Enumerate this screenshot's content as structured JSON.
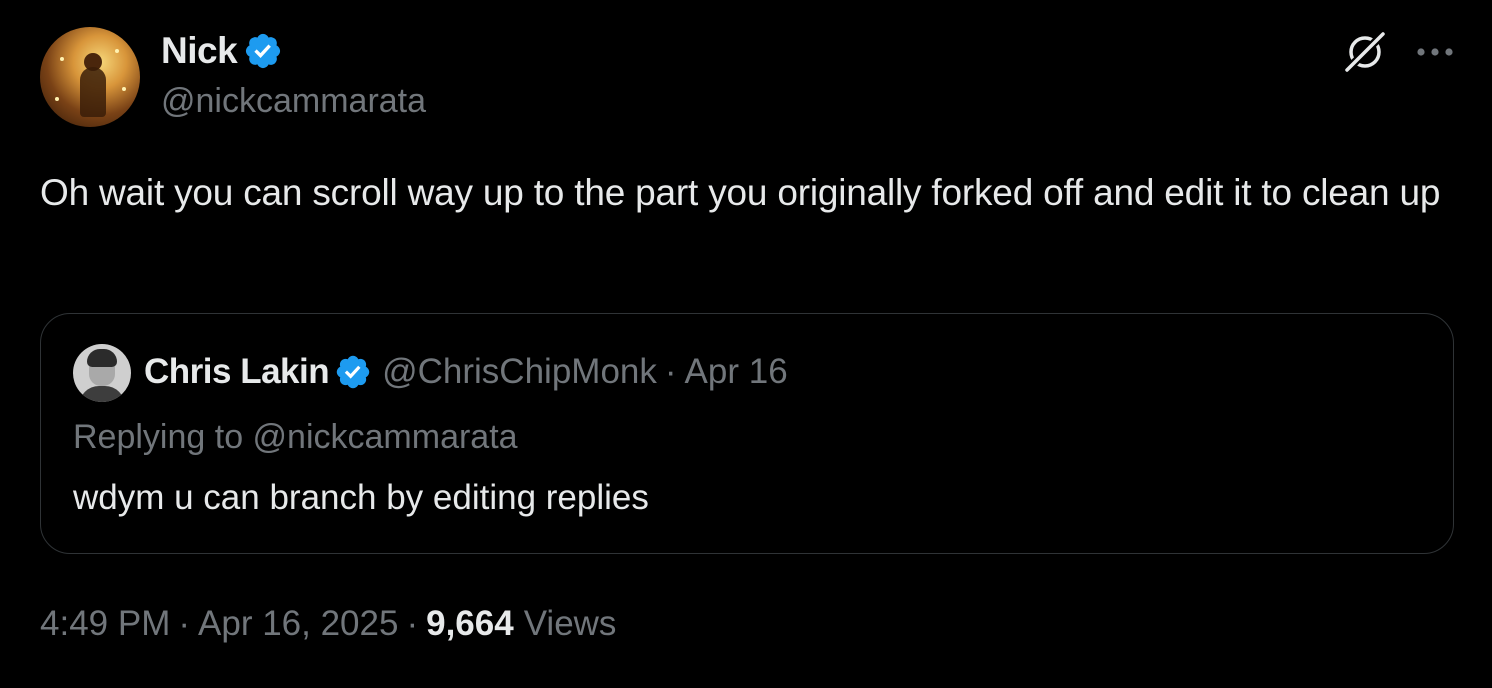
{
  "author": {
    "name": "Nick",
    "handle": "@nickcammarata",
    "verified": true
  },
  "tweet": {
    "text": "Oh wait you can scroll way up to the part you originally forked off and edit it to clean up"
  },
  "quoted_tweet": {
    "name": "Chris Lakin",
    "handle": "@ChrisChipMonk",
    "separator": "·",
    "date": "Apr 16",
    "replying_to": "Replying to @nickcammarata",
    "text": "wdym u can branch by editing replies"
  },
  "footer": {
    "time": "4:49 PM",
    "separator": "·",
    "date": "Apr 16, 2025",
    "views_count": "9,664",
    "views_label": "Views"
  },
  "colors": {
    "background": "#000000",
    "text_primary": "#e7e9ea",
    "text_secondary": "#71767b",
    "verified_blue": "#1d9bf0",
    "border": "#2f3336"
  },
  "icons": {
    "verified": "verified-badge-icon",
    "grok": "grok-icon",
    "more": "more-icon"
  }
}
